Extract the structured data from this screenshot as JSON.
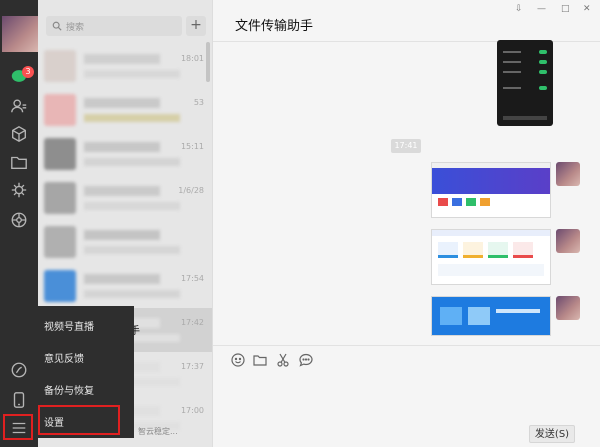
{
  "nav": {
    "badge_count": "3",
    "icons": [
      "chat-icon",
      "contacts-icon",
      "favorites-icon",
      "files-icon",
      "moments-icon",
      "mini-programs-icon",
      "channels-icon",
      "phone-icon",
      "menu-icon"
    ]
  },
  "list": {
    "search_placeholder": "搜索",
    "add_label": "+",
    "rows": [
      {
        "time": "18:01",
        "av": "#d9d0cc",
        "name": "#cfcfcf",
        "msg": "#d8d8d8"
      },
      {
        "time": "53",
        "av": "#e8b6b6",
        "name": "#c9c9c9",
        "msg": "#d6cfa8"
      },
      {
        "time": "15:11",
        "av": "#8e8e8e",
        "name": "#c7c7c7",
        "msg": "#d3d3d3"
      },
      {
        "time": "1/6/28",
        "av": "#a6a6a6",
        "name": "#cacaca",
        "msg": "#d7d7d7"
      },
      {
        "time": "",
        "av": "#b0b0b0",
        "name": "#c4c4c4",
        "msg": "#d5d5d5"
      },
      {
        "time": "17:54",
        "av": "#4a8fd8",
        "name": "#c8c8c8",
        "msg": "#d4d4d4"
      },
      {
        "time": "17:42",
        "av": "#d5d5d5",
        "name": "#e0e0e0",
        "msg": "#e0e0e0"
      },
      {
        "time": "17:37",
        "av": "#d5d5d5",
        "name": "#e0e0e0",
        "msg": "#e0e0e0"
      },
      {
        "time": "17:00",
        "av": "#d5d5d5",
        "name": "#e0e0e0",
        "msg": "#e0e0e0"
      }
    ],
    "partial_name": "手",
    "partial_msg": "智云稳定..."
  },
  "menu": {
    "items": [
      "视频号直播",
      "意见反馈",
      "备份与恢复",
      "设置"
    ]
  },
  "main": {
    "title": "文件传输助手",
    "time_chip": "17:41",
    "send_label": "发送(S)",
    "win_controls": [
      "⇩",
      "—",
      "□",
      "✕"
    ],
    "toolbar_icons": [
      "emoji-icon",
      "folder-icon",
      "scissors-icon",
      "chat-bubble-icon"
    ]
  },
  "colors": {
    "accent_green": "#2fbf6a",
    "highlight_red": "#e02020",
    "nav_bg": "#2e2e2e"
  }
}
